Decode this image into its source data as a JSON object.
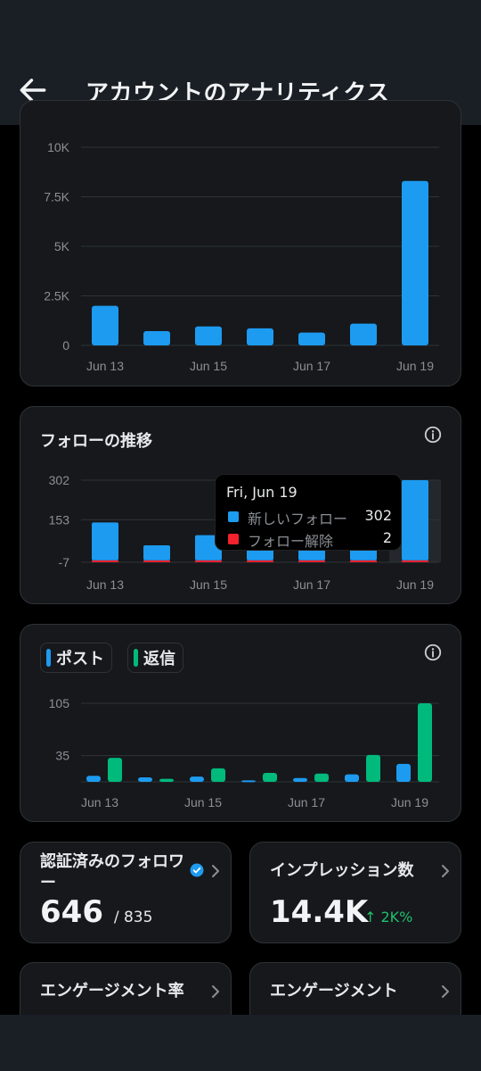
{
  "header": {
    "title": "アカウントのアナリティクス",
    "back_icon": "arrow-left-icon"
  },
  "charts": {
    "impressions": {
      "y_ticks": [
        "10K",
        "7.5K",
        "5K",
        "2.5K",
        "0"
      ],
      "x_ticks": [
        "Jun 13",
        "Jun 15",
        "Jun 17",
        "Jun 19"
      ]
    },
    "follows": {
      "title": "フォローの推移",
      "y_ticks": [
        "302",
        "153",
        "-7"
      ],
      "x_ticks": [
        "Jun 13",
        "Jun 15",
        "Jun 17",
        "Jun 19"
      ],
      "tooltip": {
        "date": "Fri, Jun 19",
        "new_label": "新しいフォロー",
        "new_value": "302",
        "unfollow_label": "フォロー解除",
        "unfollow_value": "2"
      }
    },
    "posts": {
      "legend_posts": "ポスト",
      "legend_replies": "返信",
      "y_ticks": [
        "105",
        "35"
      ],
      "x_ticks": [
        "Jun 13",
        "Jun 15",
        "Jun 17",
        "Jun 19"
      ]
    }
  },
  "chart_data": [
    {
      "type": "bar",
      "categories": [
        "Jun 13",
        "Jun 14",
        "Jun 15",
        "Jun 16",
        "Jun 17",
        "Jun 18",
        "Jun 19"
      ],
      "values": [
        2000,
        720,
        960,
        860,
        650,
        1100,
        8300
      ],
      "ylim": [
        0,
        10000
      ],
      "grid": true,
      "color": "#1d9bf0"
    },
    {
      "type": "bar",
      "title": "フォローの推移",
      "categories": [
        "Jun 13",
        "Jun 14",
        "Jun 15",
        "Jun 16",
        "Jun 17",
        "Jun 18",
        "Jun 19"
      ],
      "series": [
        {
          "name": "新しいフォロー",
          "values": [
            143,
            57,
            95,
            84,
            80,
            88,
            302
          ],
          "color": "#1d9bf0"
        },
        {
          "name": "フォロー解除",
          "values": [
            -2,
            -3,
            -1,
            -1,
            -2,
            -1,
            -2
          ],
          "color": "#f4212e"
        }
      ],
      "ylim": [
        -7,
        302
      ],
      "grid": true
    },
    {
      "type": "bar",
      "categories": [
        "Jun 13",
        "Jun 14",
        "Jun 15",
        "Jun 16",
        "Jun 17",
        "Jun 18",
        "Jun 19"
      ],
      "series": [
        {
          "name": "ポスト",
          "values": [
            8,
            6,
            7,
            2,
            5,
            10,
            24
          ],
          "color": "#1d9bf0"
        },
        {
          "name": "返信",
          "values": [
            32,
            4,
            18,
            12,
            11,
            36,
            105
          ],
          "color": "#00ba7c"
        }
      ],
      "ylim": [
        0,
        105
      ],
      "grid": true
    }
  ],
  "stats": [
    {
      "label": "認証済みのフォロワー",
      "value": "646",
      "sub": "/ 835",
      "badge_icon": "verified-badge-icon"
    },
    {
      "label": "インプレッション数",
      "value": "14.4K",
      "trend": "2K%"
    },
    {
      "label": "エンゲージメント率"
    },
    {
      "label": "エンゲージメント"
    }
  ],
  "colors": {
    "blue": "#1d9bf0",
    "green": "#00ba7c",
    "red": "#f4212e",
    "card": "#16181c",
    "bar": "#1a1f26"
  }
}
